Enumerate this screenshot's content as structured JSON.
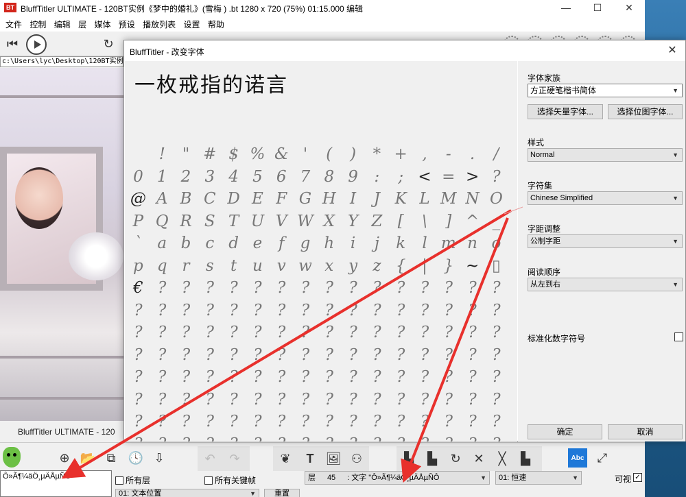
{
  "app": {
    "title": "BluffTitler ULTIMATE   - 120BT实例《梦中的婚礼》(雪梅 ) .bt 1280 x 720 (75%) 01:15.000 编辑",
    "taskline": "BluffTitler ULTIMATE  - 120",
    "path": "c:\\Users\\lyc\\Desktop\\120BT实例《",
    "window_buttons": [
      "—",
      "☐",
      "✕"
    ]
  },
  "menu": [
    "文件",
    "控制",
    "编辑",
    "层",
    "媒体",
    "预设",
    "播放列表",
    "设置",
    "帮助"
  ],
  "dialog": {
    "title": "BluffTitler - 改变字体",
    "close": "✕",
    "sample": "一枚戒指的诺言",
    "glyph_rows": [
      [
        "",
        "!",
        "\"",
        "#",
        "$",
        "%",
        "&",
        "'",
        "(",
        ")",
        "*",
        "+",
        ",",
        "-",
        ".",
        "/"
      ],
      [
        "0",
        "1",
        "2",
        "3",
        "4",
        "5",
        "6",
        "7",
        "8",
        "9",
        ":",
        ";",
        "<",
        "=",
        ">",
        "?"
      ],
      [
        "@",
        "A",
        "B",
        "C",
        "D",
        "E",
        "F",
        "G",
        "H",
        "I",
        "J",
        "K",
        "L",
        "M",
        "N",
        "O"
      ],
      [
        "P",
        "Q",
        "R",
        "S",
        "T",
        "U",
        "V",
        "W",
        "X",
        "Y",
        "Z",
        "[",
        "\\",
        "]",
        "^",
        "_"
      ],
      [
        "`",
        "a",
        "b",
        "c",
        "d",
        "e",
        "f",
        "g",
        "h",
        "i",
        "j",
        "k",
        "l",
        "m",
        "n",
        "o"
      ],
      [
        "p",
        "q",
        "r",
        "s",
        "t",
        "u",
        "v",
        "w",
        "x",
        "y",
        "z",
        "{",
        "|",
        "}",
        "~",
        "▯"
      ],
      [
        "€",
        "?",
        "?",
        "?",
        "?",
        "?",
        "?",
        "?",
        "?",
        "?",
        "?",
        "?",
        "?",
        "?",
        "?",
        "?"
      ],
      [
        "?",
        "?",
        "?",
        "?",
        "?",
        "?",
        "?",
        "?",
        "?",
        "?",
        "?",
        "?",
        "?",
        "?",
        "?",
        "?"
      ],
      [
        "?",
        "?",
        "?",
        "?",
        "?",
        "?",
        "?",
        "?",
        "?",
        "?",
        "?",
        "?",
        "?",
        "?",
        "?",
        "?"
      ],
      [
        "?",
        "?",
        "?",
        "?",
        "?",
        "?",
        "?",
        "?",
        "?",
        "?",
        "?",
        "?",
        "?",
        "?",
        "?",
        "?"
      ],
      [
        "?",
        "?",
        "?",
        "?",
        "?",
        "?",
        "?",
        "?",
        "?",
        "?",
        "?",
        "?",
        "?",
        "?",
        "?",
        "?"
      ],
      [
        "?",
        "?",
        "?",
        "?",
        "?",
        "?",
        "?",
        "?",
        "?",
        "?",
        "?",
        "?",
        "?",
        "?",
        "?",
        "?"
      ],
      [
        "?",
        "?",
        "?",
        "?",
        "?",
        "?",
        "?",
        "?",
        "?",
        "?",
        "?",
        "?",
        "?",
        "?",
        "?",
        "?"
      ],
      [
        "?",
        "?",
        "?",
        "?",
        "?",
        "?",
        "?",
        "?",
        "?",
        "?",
        "?",
        "?",
        "?",
        "?",
        "?",
        "?"
      ]
    ],
    "font_family_label": "字体家族",
    "font_family_value": "方正硬笔楷书简体",
    "vector_font_btn": "选择矢量字体...",
    "bitmap_font_btn": "选择位图字体...",
    "style_label": "样式",
    "style_value": "Normal",
    "charset_label": "字符集",
    "charset_value": "Chinese Simplified",
    "kerning_label": "字距调整",
    "kerning_value": "公制字距",
    "reading_order_label": "阅读顺序",
    "reading_order_value": "从左到右",
    "normalize_label": "标准化数字符号",
    "ok_btn": "确定",
    "cancel_btn": "取消"
  },
  "bottom": {
    "layer_text": "Ô»Ã¶¼äÖ¸µÄÅµÑÔ",
    "all_layers": "所有层",
    "all_keyframes": "所有关键帧",
    "layer_combo_prefix": "层",
    "layer_number": "45",
    "layer_combo_text": ": 文字 \"Ô»Ã¶¼äÖ¸µÄÅµÑÔ",
    "speed": "01: 恒速",
    "visible": "可视",
    "visible_check": "✓",
    "prop_combo": "01: 文本位置",
    "reset": "重置",
    "selected_icon_text": "Abc"
  },
  "colors": {
    "accent": "#1e78d8",
    "arrow": "#e8302c",
    "glyph": "#777777"
  }
}
